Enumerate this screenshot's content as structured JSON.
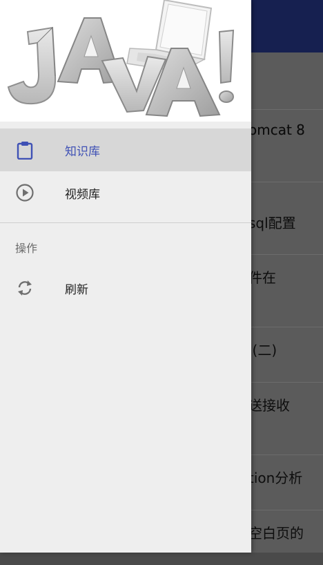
{
  "background_list": {
    "items": [
      "omcat 8",
      "sql配置",
      "件在",
      "l(二)",
      "送接收",
      "tion分析",
      "空白页的"
    ]
  },
  "drawer": {
    "header_image_text": "JAVA!",
    "menu": [
      {
        "label": "知识库",
        "icon": "clipboard-icon",
        "active": true
      },
      {
        "label": "视频库",
        "icon": "play-circle-icon",
        "active": false
      }
    ],
    "section_title": "操作",
    "actions": [
      {
        "label": "刷新",
        "icon": "refresh-icon"
      }
    ]
  },
  "colors": {
    "app_bar": "#162050",
    "accent": "#3f51b5",
    "active_bg": "#d7d7d7"
  }
}
